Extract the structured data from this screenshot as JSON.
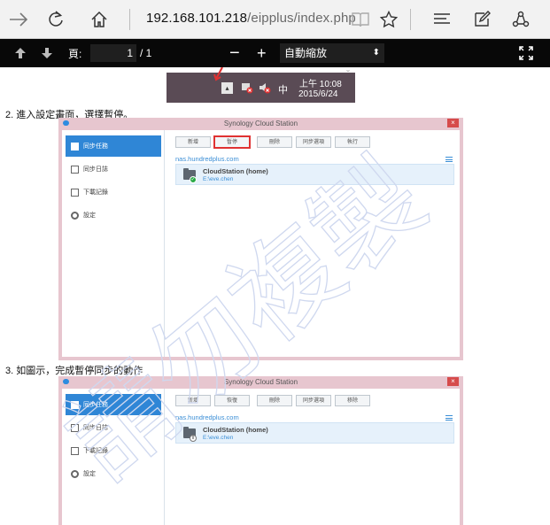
{
  "browser": {
    "address_host": "192.168.101.218",
    "address_path": "/eipplus/index.php"
  },
  "pdf_toolbar": {
    "page_label": "頁:",
    "page_current": "1",
    "page_total": "/ 1",
    "zoom_minus": "−",
    "zoom_plus": "+",
    "zoom_value": "自動縮放"
  },
  "taskbar": {
    "ime": "中",
    "time": "上午 10:08",
    "date": "2015/6/24"
  },
  "steps": [
    "2. 進入設定畫面，選擇暫停。",
    "3. 如圖示，完成暫停同步的動作"
  ],
  "app_window_1": {
    "title": "Synology Cloud Station",
    "close": "×",
    "sidebar": [
      "同步任務",
      "同步日誌",
      "下載記錄",
      "設定"
    ],
    "toolbar": [
      "新增",
      "暫停",
      "刪除",
      "同步選項",
      "執行"
    ],
    "server": "nas.hundredplus.com",
    "task_name": "CloudStation (home)",
    "task_path": "E:\\eve.chen",
    "status_badge": "✓"
  },
  "app_window_2": {
    "title": "Synology Cloud Station",
    "close": "×",
    "sidebar": [
      "同步任務",
      "同步日誌",
      "下載記錄",
      "設定"
    ],
    "toolbar": [
      "新增",
      "恢復",
      "刪除",
      "同步選項",
      "移除"
    ],
    "server": "nas.hundredplus.com",
    "task_name": "CloudStation (home)",
    "task_path": "E:\\eve.chen",
    "status_badge": "II"
  },
  "watermark": "請勿複製",
  "colors": {
    "accent": "#2f86d6",
    "window_frame": "#e7c6cf",
    "highlight": "#e03232"
  }
}
